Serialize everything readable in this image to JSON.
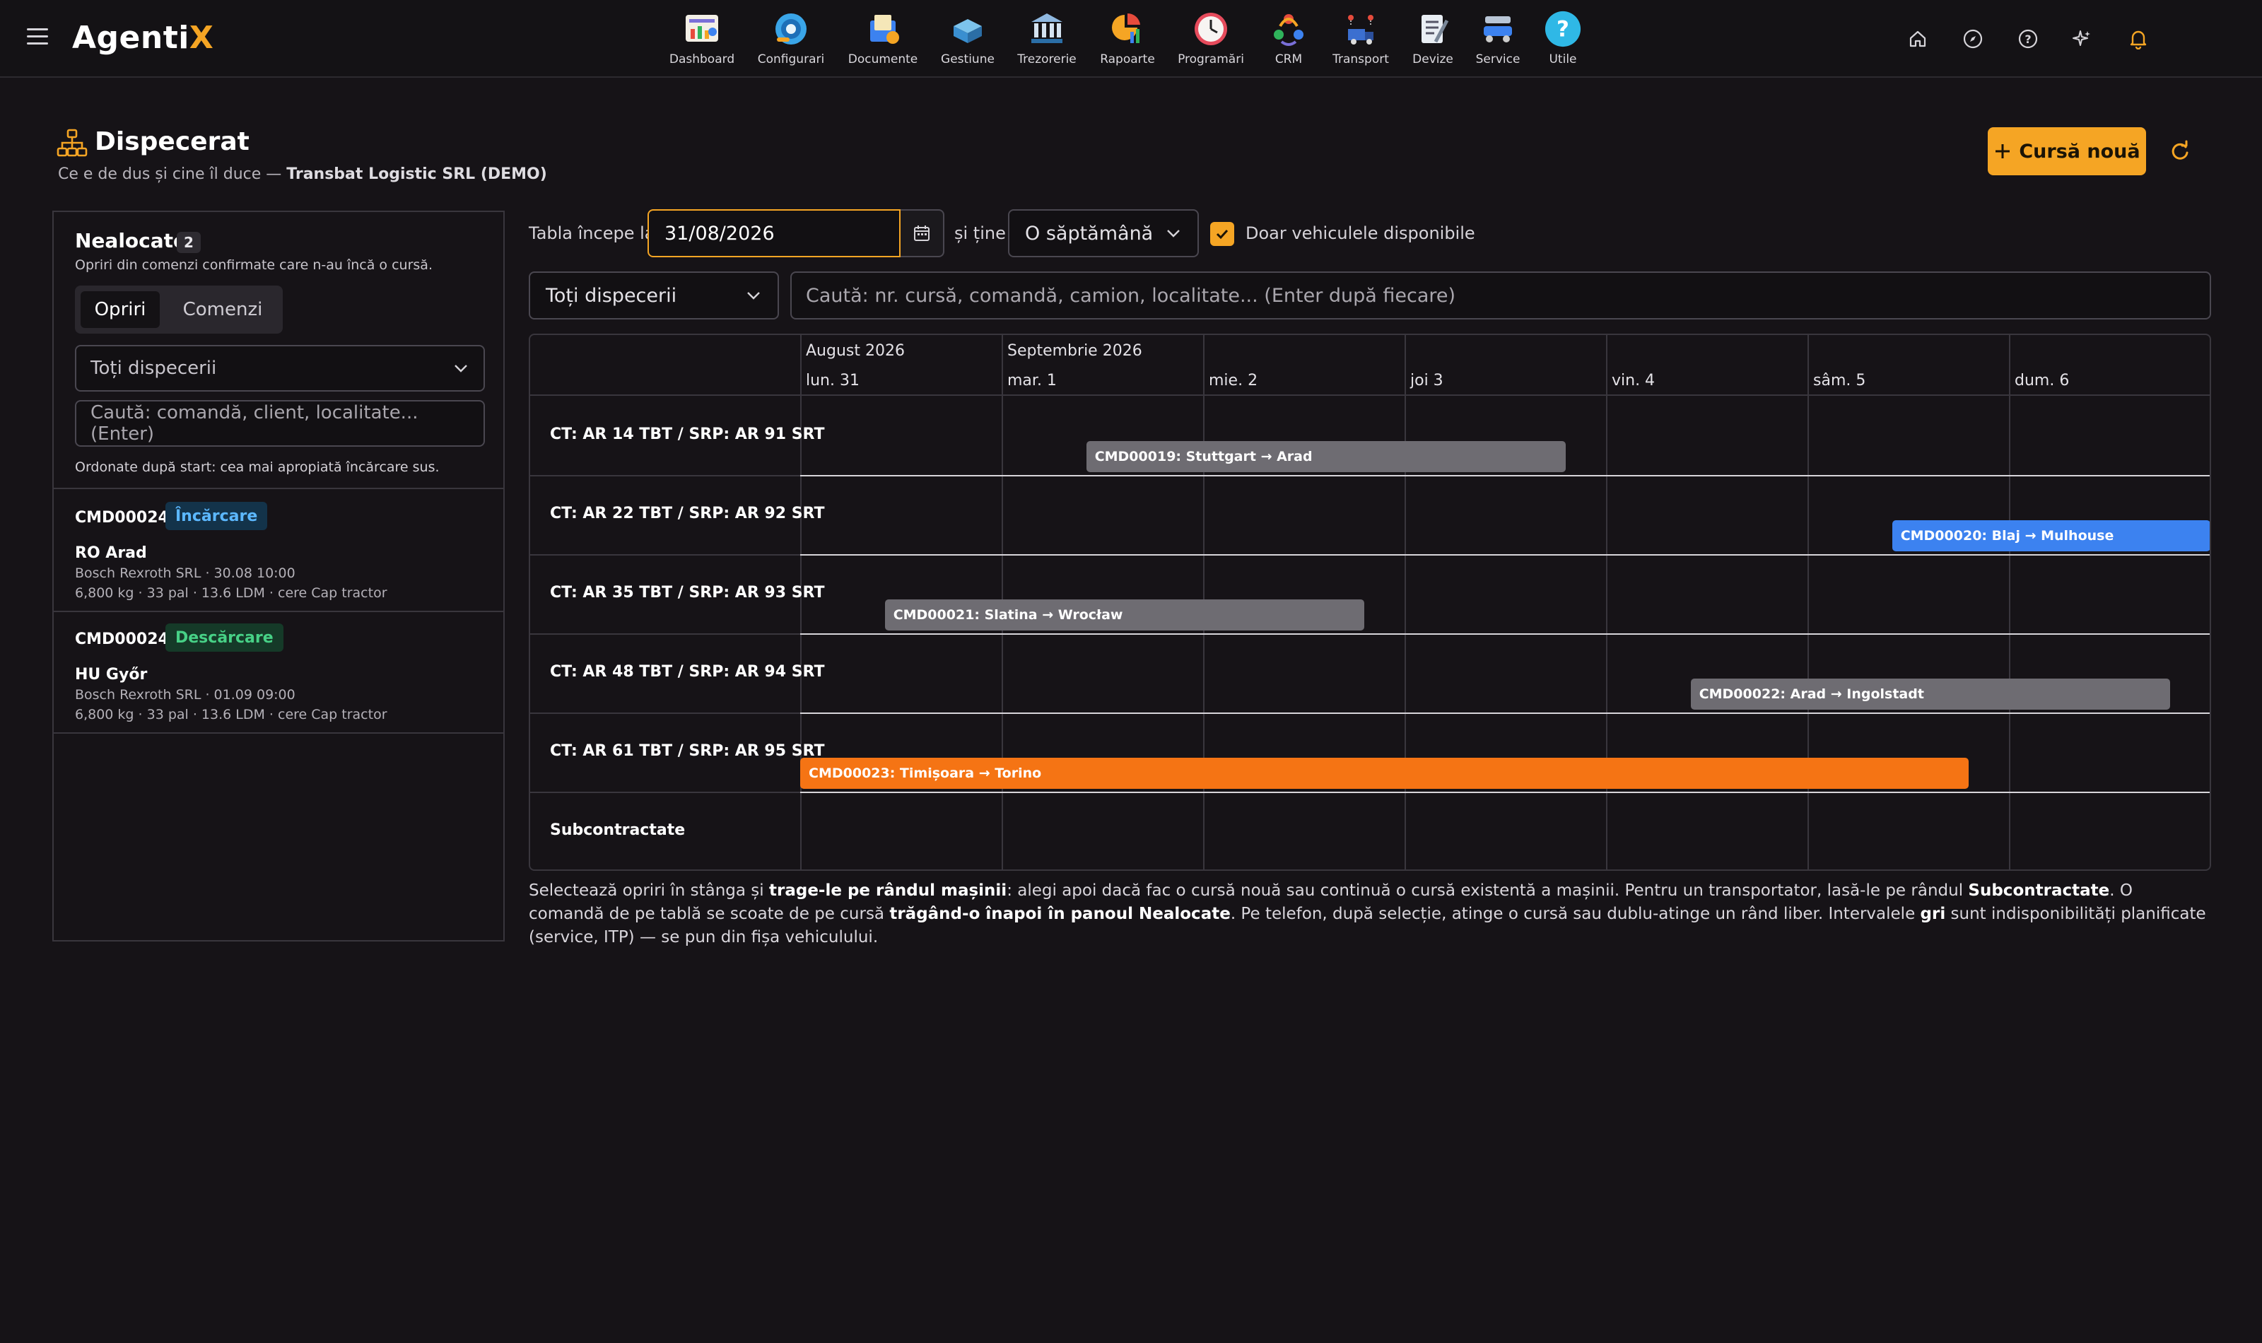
{
  "app": {
    "logo_main": "Agenti",
    "logo_accent": "X"
  },
  "nav": [
    {
      "label": "Dashboard",
      "icon": "dashboard-icon"
    },
    {
      "label": "Configurari",
      "icon": "configuration-icon"
    },
    {
      "label": "Documente",
      "icon": "documents-icon"
    },
    {
      "label": "Gestiune",
      "icon": "inventory-icon"
    },
    {
      "label": "Trezorerie",
      "icon": "treasury-icon"
    },
    {
      "label": "Rapoarte",
      "icon": "reports-icon"
    },
    {
      "label": "Programări",
      "icon": "clock-icon"
    },
    {
      "label": "CRM",
      "icon": "crm-icon"
    },
    {
      "label": "Transport",
      "icon": "transport-icon"
    },
    {
      "label": "Devize",
      "icon": "estimates-icon"
    },
    {
      "label": "Service",
      "icon": "service-icon"
    },
    {
      "label": "Utile",
      "icon": "help-question-icon"
    }
  ],
  "header": {
    "title": "Dispecerat",
    "subtitle_prefix": "Ce e de dus și cine îl duce — ",
    "subtitle_company": "Transbat Logistic SRL (DEMO)",
    "new_button": "Cursă nouă"
  },
  "left_panel": {
    "title": "Nealocate",
    "count": "2",
    "description": "Opriri din comenzi confirmate care n-au încă o cursă.",
    "tabs": [
      "Opriri",
      "Comenzi"
    ],
    "dispatcher_select": "Toți dispecerii",
    "search_placeholder": "Caută: comandă, client, localitate... (Enter)",
    "sort_note": "Ordonate după start: cea mai apropiată încărcare sus.",
    "items": [
      {
        "order": "CMD00024",
        "tag": "Încărcare",
        "place": "RO Arad",
        "client": "Bosch Rexroth SRL · 30.08 10:00",
        "details": "6,800 kg · 33 pal · 13.6 LDM · cere Cap tractor"
      },
      {
        "order": "CMD00024",
        "tag": "Descărcare",
        "place": "HU Győr",
        "client": "Bosch Rexroth SRL · 01.09 09:00",
        "details": "6,800 kg · 33 pal · 13.6 LDM · cere Cap tractor"
      }
    ]
  },
  "toolbar": {
    "starts_label": "Tabla începe la",
    "date_value": "31/08/2026",
    "holds_label": "și ține",
    "period_value": "O săptămână",
    "available_only_label": "Doar vehiculele disponibile",
    "available_only_checked": true,
    "dispatcher_value": "Toți dispecerii",
    "search_placeholder": "Caută: nr. cursă, comandă, camion, localitate... (Enter după fiecare)"
  },
  "board": {
    "months": [
      {
        "label": "August 2026",
        "start_day": 0
      },
      {
        "label": "Septembrie 2026",
        "start_day": 1
      }
    ],
    "days": [
      "lun. 31",
      "mar. 1",
      "mie. 2",
      "joi 3",
      "vin. 4",
      "sâm. 5",
      "dum. 6"
    ],
    "rows": [
      {
        "label": "CT: AR 14 TBT / SRP: AR 91 SRT"
      },
      {
        "label": "CT: AR 22 TBT / SRP: AR 92 SRT"
      },
      {
        "label": "CT: AR 35 TBT / SRP: AR 93 SRT"
      },
      {
        "label": "CT: AR 48 TBT / SRP: AR 94 SRT"
      },
      {
        "label": "CT: AR 61 TBT / SRP: AR 95 SRT"
      },
      {
        "label": "Subcontractate"
      }
    ],
    "trips": [
      {
        "label": "CMD00019: Stuttgart → Arad",
        "row": 0,
        "start_day": 1.42,
        "end_day": 3.8,
        "color": "grey"
      },
      {
        "label": "CMD00020: Blaj → Mulhouse",
        "row": 1,
        "start_day": 5.42,
        "end_day": 7.0,
        "color": "blue"
      },
      {
        "label": "CMD00021: Slatina → Wrocław",
        "row": 2,
        "start_day": 0.42,
        "end_day": 2.8,
        "color": "grey"
      },
      {
        "label": "CMD00022: Arad → Ingolstadt",
        "row": 3,
        "start_day": 4.42,
        "end_day": 6.8,
        "color": "grey"
      },
      {
        "label": "CMD00023: Timișoara → Torino",
        "row": 4,
        "start_day": 0.0,
        "end_day": 5.8,
        "color": "orange"
      }
    ]
  },
  "help": {
    "p1": "Selectează opriri în stânga și ",
    "b1": "trage-le pe rândul mașinii",
    "p2": ": alegi apoi dacă fac o cursă nouă sau continuă o cursă existentă a mașinii. Pentru un transportator, lasă-le pe rândul ",
    "b2": "Subcontractate",
    "p3": ". O comandă de pe tablă se scoate de pe cursă ",
    "b3": "trăgând-o înapoi în panoul Nealocate",
    "p4": ". Pe telefon, după selecție, atinge o cursă sau dublu-atinge un rând liber. Intervalele ",
    "b4": "gri",
    "p5": " sunt indisponibilități planificate (service, ITP) — se pun din fișa vehiculului."
  },
  "colors": {
    "accent": "#f5a524",
    "blue_trip": "#3c82f0",
    "orange_trip": "#f57414",
    "grey_trip": "#6e6c72"
  }
}
